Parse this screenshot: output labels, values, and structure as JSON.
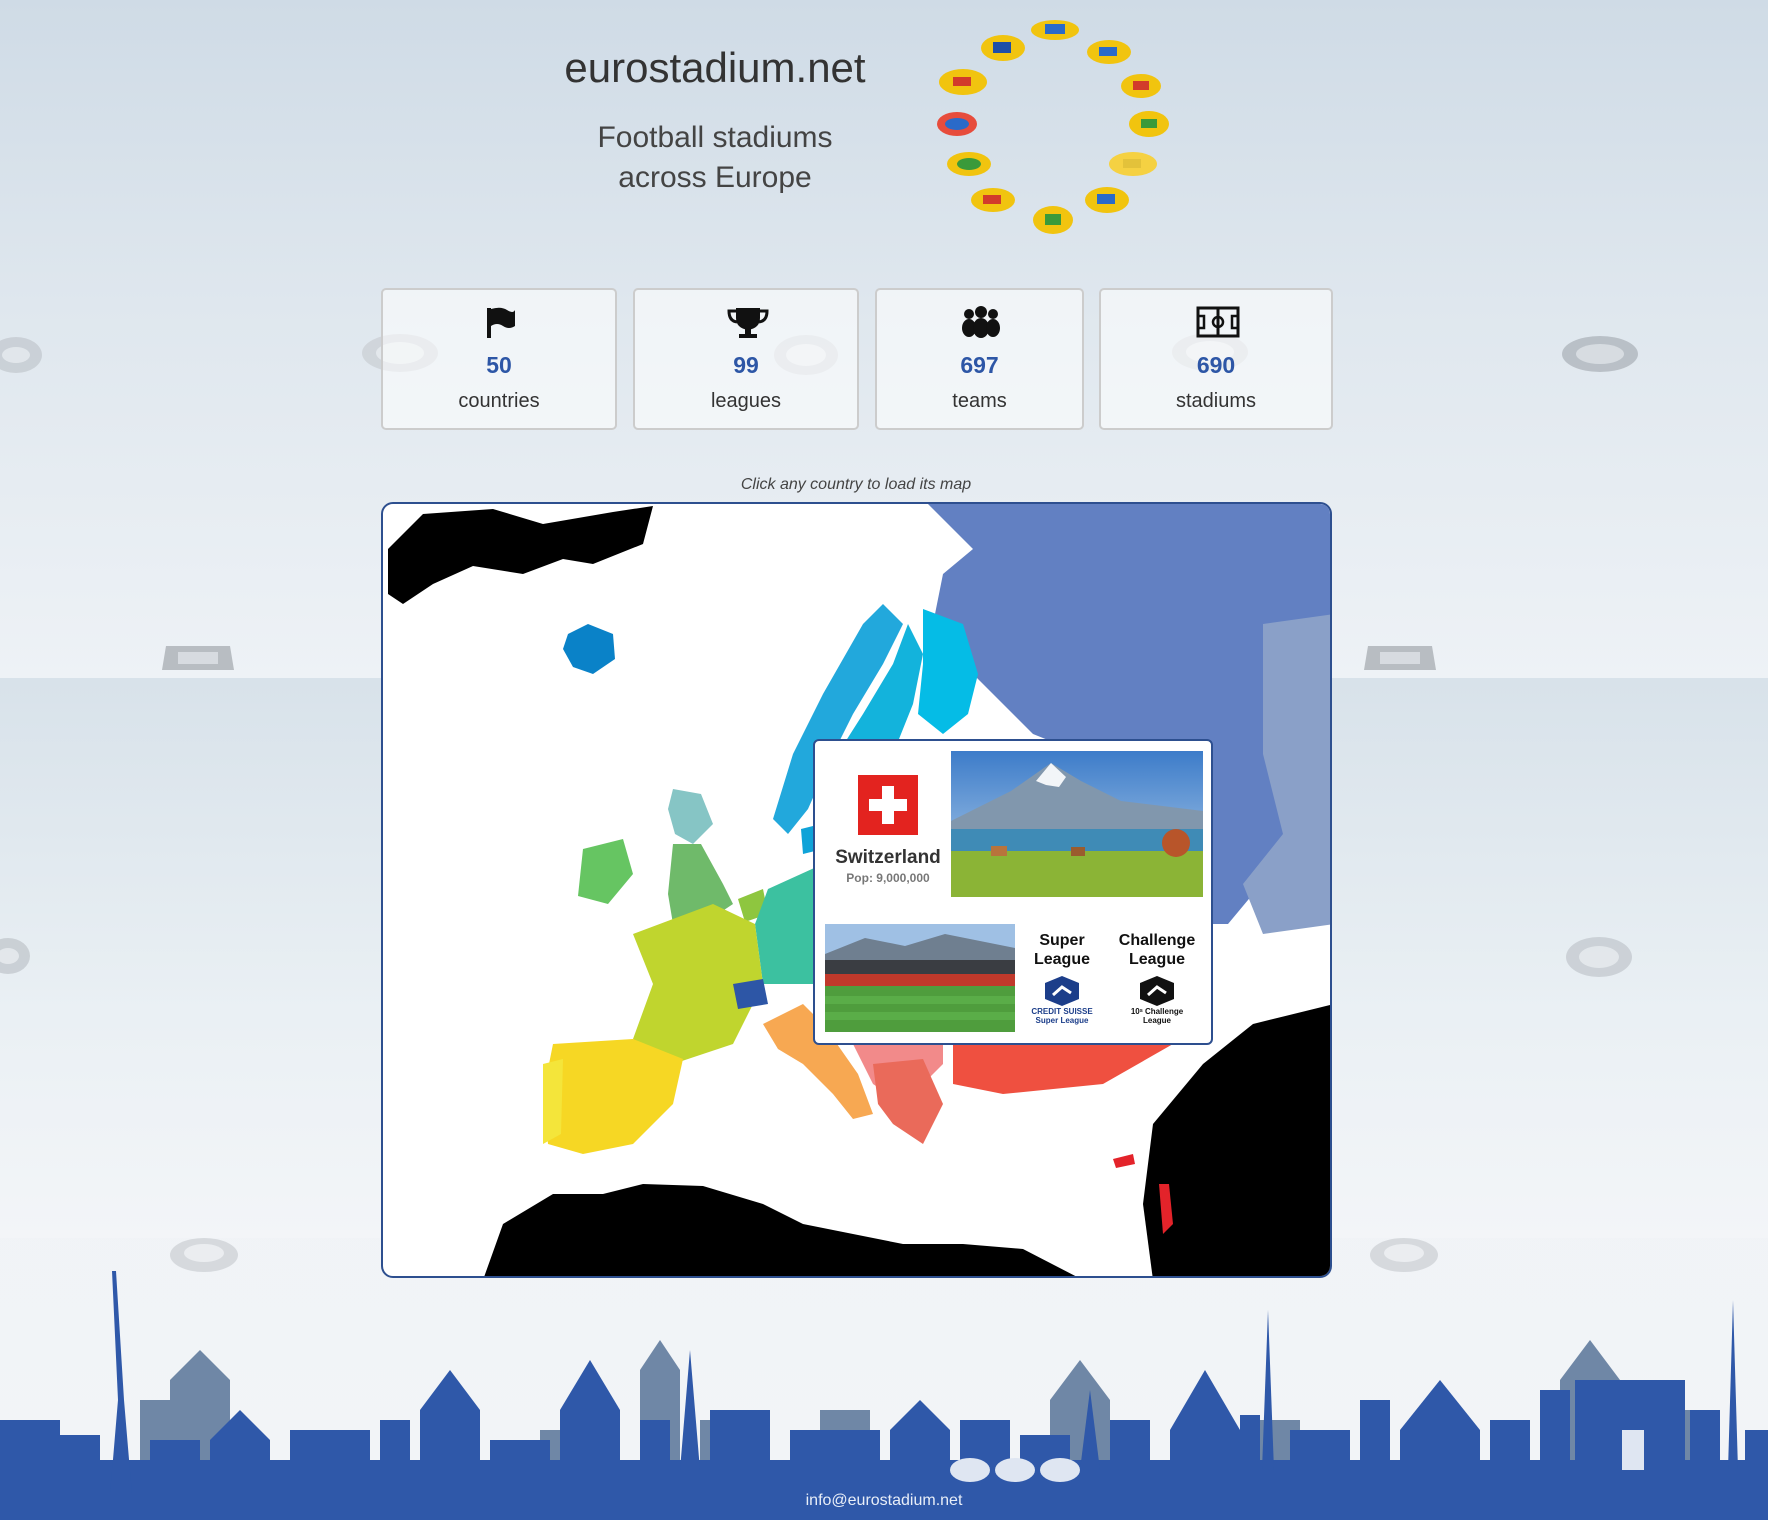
{
  "header": {
    "site_title": "eurostadium.net",
    "tagline_line1": "Football stadiums",
    "tagline_line2": "across Europe",
    "logo": "ring of stadium icons"
  },
  "stats": [
    {
      "icon": "flag-icon",
      "value": "50",
      "label": "countries"
    },
    {
      "icon": "trophy-icon",
      "value": "99",
      "label": "leagues"
    },
    {
      "icon": "team-icon",
      "value": "697",
      "label": "teams"
    },
    {
      "icon": "pitch-icon",
      "value": "690",
      "label": "stadiums"
    }
  ],
  "map": {
    "hint": "Click any country to load its map",
    "popup": {
      "country": "Switzerland",
      "population": "Pop: 9,000,000",
      "flag_colors": [
        "#e3231f",
        "#ffffff"
      ],
      "leagues": [
        {
          "name_line1": "Super",
          "name_line2": "League",
          "logo_caption1": "CREDIT SUISSE",
          "logo_caption2": "Super League"
        },
        {
          "name_line1": "Challenge",
          "name_line2": "League",
          "logo_caption1": "10ˢ Challenge",
          "logo_caption2": "League"
        }
      ]
    }
  },
  "footer": {
    "email": "info@eurostadium.net"
  },
  "colors": {
    "accent": "#2d56a6",
    "skyline": "#2f58a9",
    "skyline_back": "#6f87a6",
    "map_border": "#2d4f8f"
  }
}
